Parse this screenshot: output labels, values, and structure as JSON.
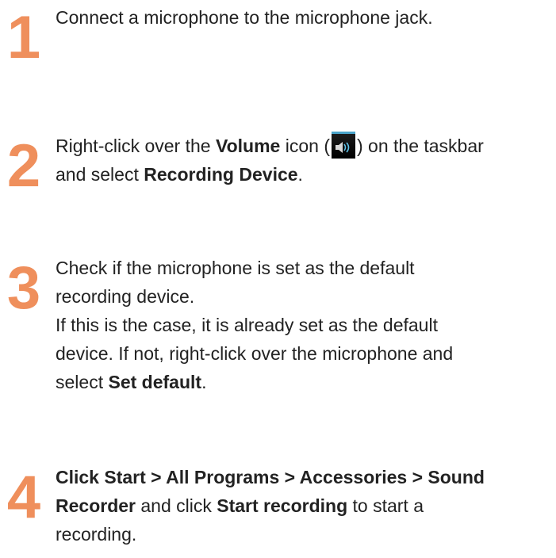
{
  "steps": [
    {
      "number": "1",
      "segments": [
        {
          "text": "Connect a microphone to the microphone jack.",
          "bold": false
        }
      ]
    },
    {
      "number": "2",
      "before_icon": "Right-click over the ",
      "bold_volume": "Volume",
      "icon_prefix": " icon (",
      "icon_suffix": ") on the taskbar",
      "line2_before": "and select ",
      "line2_bold": "Recording Device",
      "line2_after": ".",
      "icon": "speaker-volume-icon"
    },
    {
      "number": "3",
      "line1": "Check if the microphone is set as the default",
      "line2": "recording device.",
      "line3": "If this is the case, it is already set as the default",
      "line4": "device. If not, right-click over the microphone and",
      "line5_before": "select ",
      "line5_bold": "Set default",
      "line5_after": "."
    },
    {
      "number": "4",
      "line1_bold": "Click Start > All Programs > Accessories > Sound",
      "line2_bold1": "Recorder",
      "line2_mid": " and click ",
      "line2_bold2": "Start recording",
      "line2_after": " to start a",
      "line3": "recording."
    }
  ],
  "colors": {
    "step_number": "#ef8f5c",
    "text": "#222222"
  }
}
